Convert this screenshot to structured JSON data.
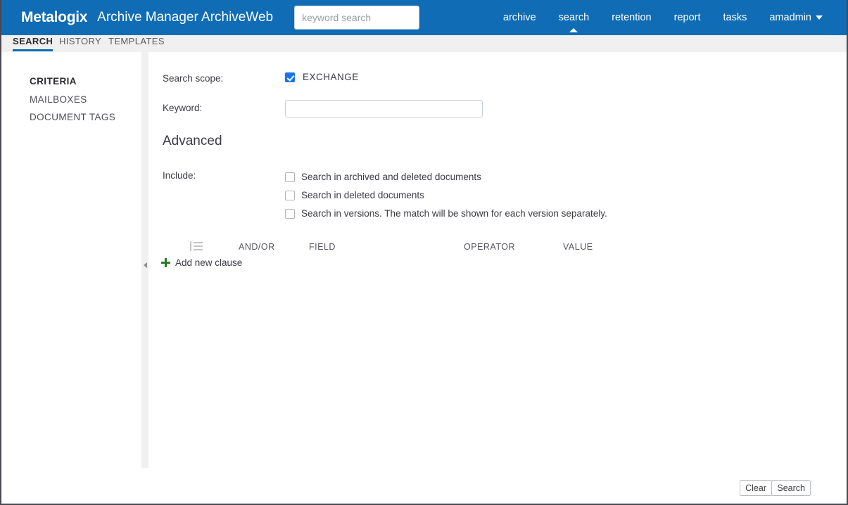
{
  "header": {
    "brand": "Metalogix",
    "app_title": "Archive Manager ArchiveWeb",
    "search_placeholder": "keyword search",
    "search_value": "",
    "nav": [
      {
        "label": "archive",
        "active": false
      },
      {
        "label": "search",
        "active": true
      },
      {
        "label": "retention",
        "active": false
      },
      {
        "label": "report",
        "active": false
      },
      {
        "label": "tasks",
        "active": false
      }
    ],
    "user_menu": "amadmin",
    "brand_color": "#0f6cb5"
  },
  "tabs": [
    {
      "label": "SEARCH",
      "active": true
    },
    {
      "label": "HISTORY",
      "active": false
    },
    {
      "label": "TEMPLATES",
      "active": false
    }
  ],
  "sidebar": {
    "items": [
      {
        "label": "CRITERIA",
        "active": true
      },
      {
        "label": "MAILBOXES",
        "active": false
      },
      {
        "label": "DOCUMENT TAGS",
        "active": false
      }
    ]
  },
  "main": {
    "scope_label": "Search scope:",
    "scope_option": "EXCHANGE",
    "scope_checked": true,
    "keyword_label": "Keyword:",
    "keyword_value": "",
    "advanced_title": "Advanced",
    "include_label": "Include:",
    "include_options": [
      {
        "label": "Search in archived and deleted documents",
        "checked": false
      },
      {
        "label": "Search in deleted documents",
        "checked": false
      },
      {
        "label": "Search in versions. The match will be shown for each version separately.",
        "checked": false
      }
    ],
    "clause_columns": {
      "order_icon": "list-icon",
      "andor": "AND/OR",
      "field": "FIELD",
      "operator": "OPERATOR",
      "value": "VALUE"
    },
    "clause_rows": [],
    "add_clause_label": "Add new clause",
    "add_clause_color": "#2a7a2a"
  },
  "footer": {
    "clear_label": "Clear",
    "search_label": "Search"
  }
}
